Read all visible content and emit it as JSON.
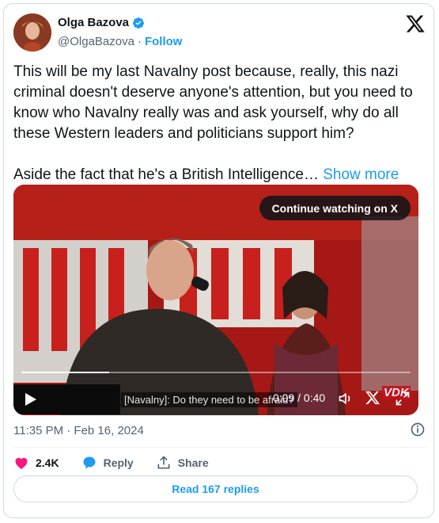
{
  "author": {
    "name": "Olga Bazova",
    "handle": "@OlgaBazova",
    "separator": "·",
    "follow_label": "Follow",
    "verified": true
  },
  "tweet": {
    "text": "This will be my last Navalny post because, really, this nazi criminal doesn't deserve anyone's attention, but you need to know who Navalny really was and ask yourself, why do all these Western leaders and politicians support him?\n\nAside the fact that he's a British Intelligence…",
    "show_more_label": "Show more"
  },
  "video": {
    "continue_label": "Continue watching on X",
    "subtitle": "[Navalny]: Do they need to be afraid?",
    "time": "0:09 / 0:40",
    "progress": 0.225,
    "watermark": "VDK"
  },
  "meta": {
    "timestamp": "11:35 PM · Feb 16, 2024"
  },
  "actions": {
    "likes": "2.4K",
    "reply_label": "Reply",
    "share_label": "Share"
  },
  "replies_button": "Read 167 replies",
  "colors": {
    "accent": "#1d9bf0",
    "heart": "#f91880",
    "text": "#0f1419",
    "muted": "#536471"
  }
}
